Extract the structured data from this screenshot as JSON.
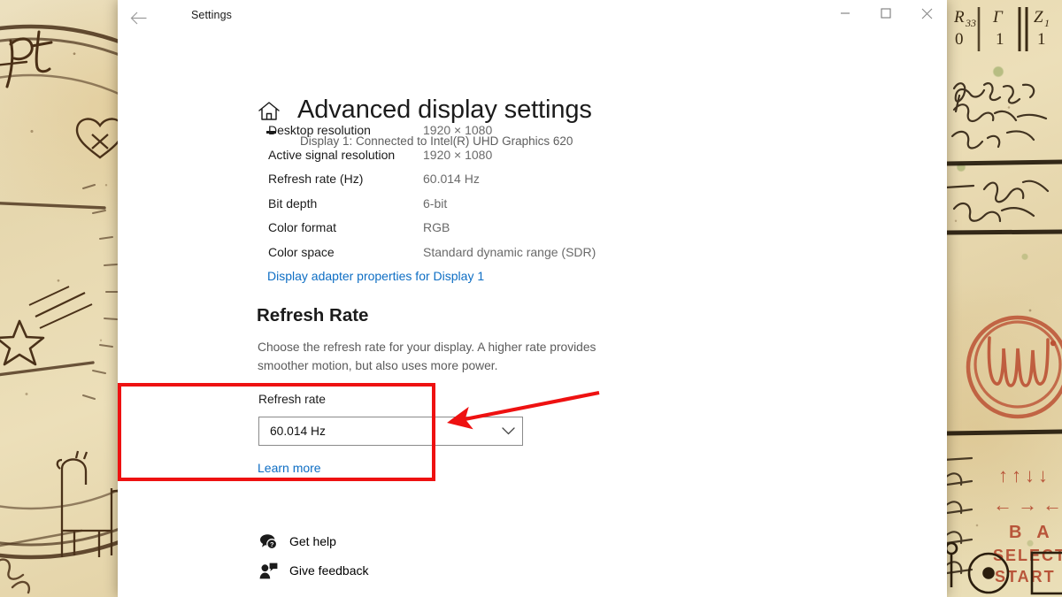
{
  "window": {
    "app_title": "Settings",
    "back_icon": "back-arrow-icon",
    "controls": {
      "minimize": "minimize-icon",
      "maximize": "maximize-icon",
      "close": "close-icon"
    }
  },
  "page": {
    "home_icon": "home-icon",
    "title": "Advanced display settings",
    "subtitle": "Display 1: Connected to Intel(R) UHD Graphics 620"
  },
  "details": {
    "rows": [
      {
        "label": "Desktop resolution",
        "value": "1920 × 1080"
      },
      {
        "label": "Active signal resolution",
        "value": "1920 × 1080"
      },
      {
        "label": "Refresh rate (Hz)",
        "value": "60.014 Hz"
      },
      {
        "label": "Bit depth",
        "value": "6-bit"
      },
      {
        "label": "Color format",
        "value": "RGB"
      },
      {
        "label": "Color space",
        "value": "Standard dynamic range (SDR)"
      }
    ],
    "adapter_link": "Display adapter properties for Display 1"
  },
  "refresh_rate": {
    "heading": "Refresh Rate",
    "description": "Choose the refresh rate for your display. A higher rate provides smoother motion, but also uses more power.",
    "field_label": "Refresh rate",
    "selected_value": "60.014 Hz",
    "chevron_icon": "chevron-down-icon",
    "learn_more": "Learn more"
  },
  "footer": {
    "get_help": {
      "label": "Get help",
      "icon": "help-bubble-icon"
    },
    "give_feedback": {
      "label": "Give feedback",
      "icon": "feedback-person-icon"
    }
  },
  "annotations": {
    "highlight_color": "#ee1111",
    "arrow_icon": "red-pointer-arrow"
  },
  "theme": {
    "link_color": "#0e6ec4",
    "text_color": "#1b1b1b",
    "muted_text_color": "#6a6a6a",
    "window_bg": "#ffffff",
    "combo_border": "#8a8a8a"
  },
  "wallpaper": {
    "description": "aged parchment manuscript",
    "marks": {
      "top_right_table": [
        "R",
        "33",
        "Γ",
        "Z",
        "1",
        "0",
        "1",
        "1"
      ],
      "konami_arrows": "↑ ↑ ↓ ↓ ← → ←",
      "konami_buttons": "B A",
      "konami_select": "SELECT",
      "konami_start": "START",
      "left_letters": "pt"
    }
  }
}
